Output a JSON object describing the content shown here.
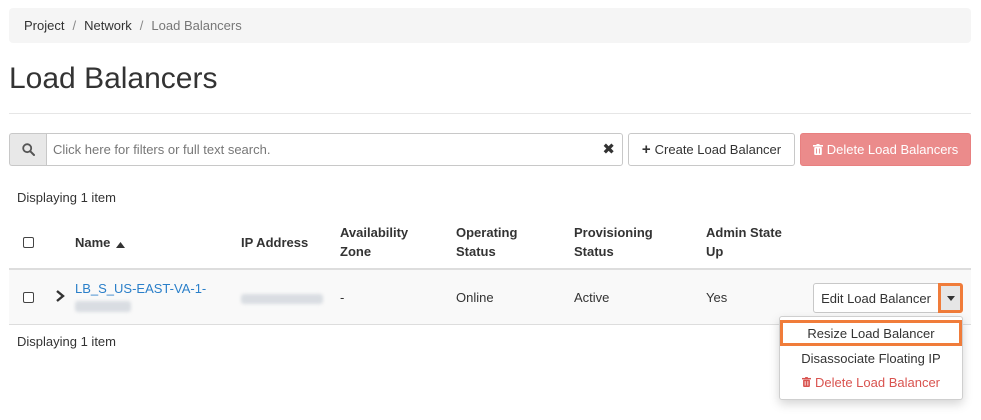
{
  "breadcrumb": {
    "items": [
      "Project",
      "Network",
      "Load Balancers"
    ],
    "separator": "/"
  },
  "page": {
    "title": "Load Balancers"
  },
  "search": {
    "placeholder": "Click here for filters or full text search.",
    "value": "",
    "clear_glyph": "✖"
  },
  "actions": {
    "create_icon": "plus-icon",
    "create_label": "Create Load Balancer",
    "delete_icon": "trash-icon",
    "delete_label": "Delete Load Balancers"
  },
  "table": {
    "count_label": "Displaying 1 item",
    "columns": [
      {
        "label": "Name",
        "sort": "ascending"
      },
      {
        "label": "IP Address"
      },
      {
        "label": "Availability",
        "label2": "Zone"
      },
      {
        "label": "Operating",
        "label2": "Status"
      },
      {
        "label": "Provisioning",
        "label2": "Status"
      },
      {
        "label": "Admin State",
        "label2": "Up"
      }
    ],
    "rows": [
      {
        "name_line1": "LB_S_US-EAST-VA-1-",
        "name_line2_redacted": true,
        "ip_redacted": true,
        "availability_zone": "-",
        "operating_status": "Online",
        "provisioning_status": "Active",
        "admin_state_up": "Yes",
        "action_label": "Edit Load Balancer"
      }
    ],
    "footer_count_label": "Displaying 1 item"
  },
  "row_menu": {
    "items": [
      {
        "label": "Resize Load Balancer",
        "highlighted": true
      },
      {
        "label": "Disassociate Floating IP"
      },
      {
        "label": "Delete Load Balancer",
        "icon": "trash-icon",
        "danger": true
      }
    ]
  },
  "colors": {
    "accent_highlight": "#f07c3a",
    "link": "#2a7fc9",
    "danger_button": "#eb8b8b",
    "danger_text": "#d9534f"
  }
}
